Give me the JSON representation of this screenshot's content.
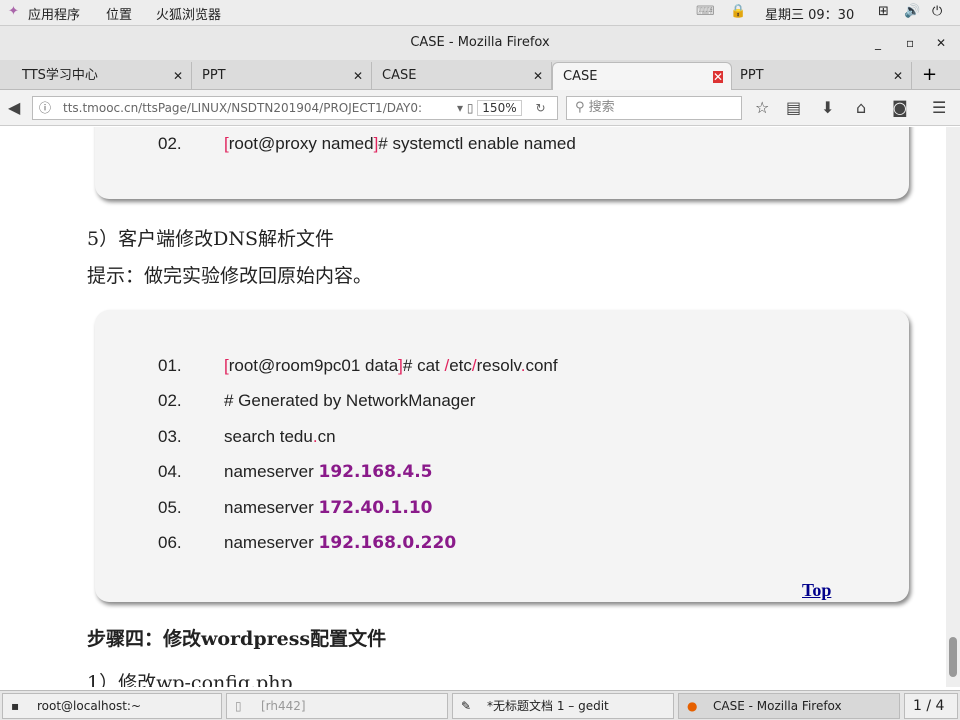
{
  "topbar": {
    "apps": "应用程序",
    "places": "位置",
    "browser": "火狐浏览器",
    "clock": "星期三 09：30"
  },
  "window": {
    "title": "CASE - Mozilla Firefox"
  },
  "tabs": [
    {
      "label": "TTS学习中心"
    },
    {
      "label": "PPT"
    },
    {
      "label": "CASE"
    },
    {
      "label": "CASE",
      "active": true
    },
    {
      "label": "PPT"
    }
  ],
  "nav": {
    "url": "tts.tmooc.cn/ttsPage/LINUX/NSDTN201904/PROJECT1/DAY0:",
    "zoom": "150%",
    "search_placeholder": "搜索"
  },
  "content": {
    "box1": [
      {
        "num": "02.",
        "prompt_user": "root@proxy named",
        "cmd": "# systemctl enable named"
      }
    ],
    "step5": "5）客户端修改DNS解析文件",
    "hint": "提示：做完实验修改回原始内容。",
    "box2": {
      "line1": {
        "num": "01.",
        "prompt_user": "root@room9pc01 data",
        "cmd_a": "# cat ",
        "s1": "/",
        "p1": "etc",
        "s2": "/",
        "p2": "resolv",
        "dot": ".",
        "p3": "conf"
      },
      "line2": {
        "num": "02.",
        "text": "# Generated by NetworkManager"
      },
      "line3": {
        "num": "03.",
        "a": "search tedu",
        "dot": ".",
        "b": "cn"
      },
      "line4": {
        "num": "04.",
        "text": "nameserver ",
        "ip": "192.168.4.5"
      },
      "line5": {
        "num": "05.",
        "text": "nameserver ",
        "ip": "172.40.1.10"
      },
      "line6": {
        "num": "06.",
        "text": "nameserver ",
        "ip": "192.168.0.220"
      },
      "top_link": "Top"
    },
    "step4_heading": "步骤四：修改wordpress配置文件",
    "sub1": "1）修改wp-config.php"
  },
  "taskbar": [
    {
      "label": "root@localhost:~"
    },
    {
      "label": "[rh442]"
    },
    {
      "label": "*无标题文档 1 – gedit"
    },
    {
      "label": "CASE - Mozilla Firefox"
    }
  ],
  "workspace": "1 / 4",
  "colors": {
    "bracket": "#e0245e",
    "ip": "#8a1a8a",
    "link": "#00008b"
  }
}
